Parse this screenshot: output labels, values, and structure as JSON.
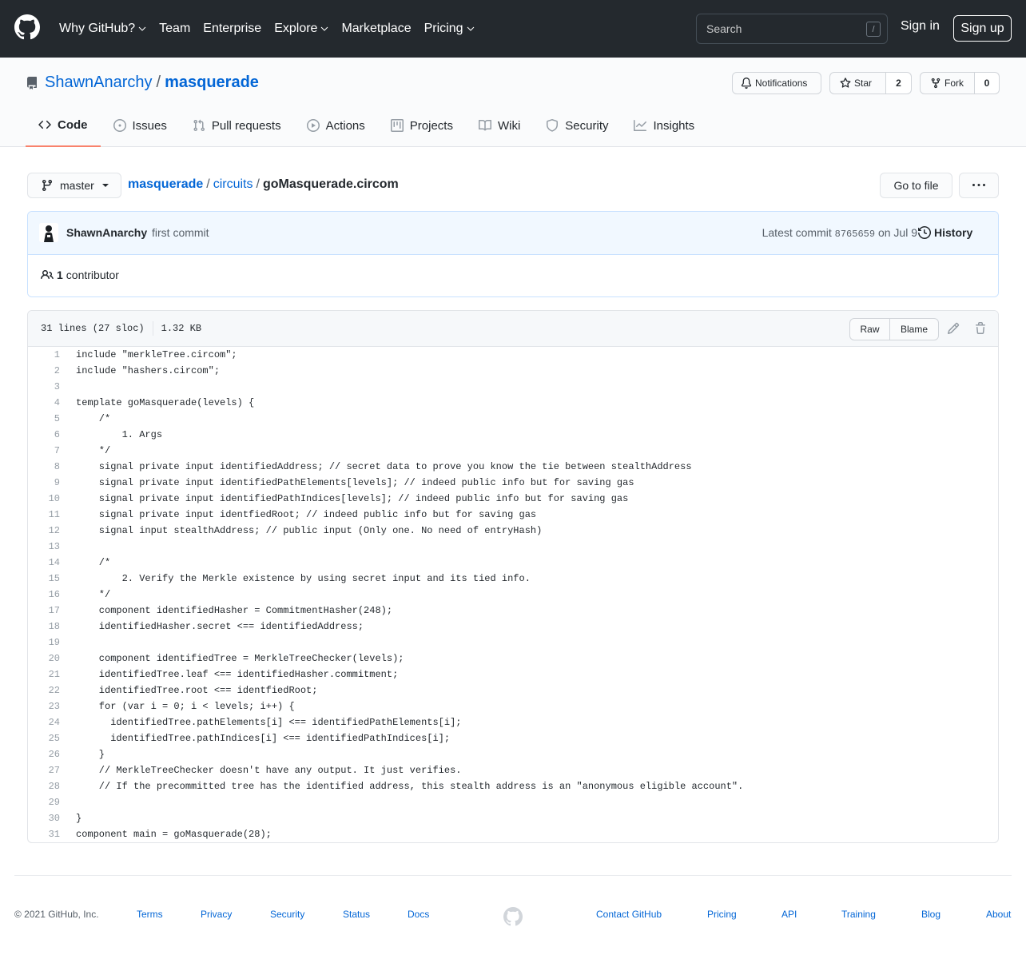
{
  "header": {
    "nav": [
      {
        "label": "Why GitHub?",
        "caret": true
      },
      {
        "label": "Team",
        "caret": false
      },
      {
        "label": "Enterprise",
        "caret": false
      },
      {
        "label": "Explore",
        "caret": true
      },
      {
        "label": "Marketplace",
        "caret": false
      },
      {
        "label": "Pricing",
        "caret": true
      }
    ],
    "search_placeholder": "Search",
    "search_hotkey": "/",
    "sign_in": "Sign in",
    "sign_up": "Sign up"
  },
  "repo": {
    "owner": "ShawnAnarchy",
    "separator": "/",
    "name": "masquerade",
    "notifications_label": "Notifications",
    "star_label": "Star",
    "star_count": "2",
    "fork_label": "Fork",
    "fork_count": "0"
  },
  "tabs": [
    {
      "label": "Code",
      "icon": "code-icon",
      "selected": true
    },
    {
      "label": "Issues",
      "icon": "issue-icon",
      "selected": false
    },
    {
      "label": "Pull requests",
      "icon": "pull-request-icon",
      "selected": false
    },
    {
      "label": "Actions",
      "icon": "play-icon",
      "selected": false
    },
    {
      "label": "Projects",
      "icon": "project-icon",
      "selected": false
    },
    {
      "label": "Wiki",
      "icon": "book-icon",
      "selected": false
    },
    {
      "label": "Security",
      "icon": "shield-icon",
      "selected": false
    },
    {
      "label": "Insights",
      "icon": "graph-icon",
      "selected": false
    }
  ],
  "branch": {
    "label": "master"
  },
  "breadcrumb": {
    "root": "masquerade",
    "dir": "circuits",
    "file": "goMasquerade.circom",
    "sep": "/"
  },
  "go_to_file": "Go to file",
  "commit": {
    "author": "ShawnAnarchy",
    "message": "first commit",
    "latest_prefix": "Latest commit",
    "sha": "8765659",
    "date_text": "on Jul 9",
    "history_label": "History"
  },
  "contributors": {
    "count": "1",
    "label": "contributor"
  },
  "file": {
    "lines_info": "31 lines (27 sloc)",
    "size": "1.32 KB",
    "raw_label": "Raw",
    "blame_label": "Blame"
  },
  "code_lines": [
    "include \"merkleTree.circom\";",
    "include \"hashers.circom\";",
    "",
    "template goMasquerade(levels) {",
    "    /*",
    "        1. Args",
    "    */",
    "    signal private input identifiedAddress; // secret data to prove you know the tie between stealthAddress",
    "    signal private input identifiedPathElements[levels]; // indeed public info but for saving gas",
    "    signal private input identifiedPathIndices[levels]; // indeed public info but for saving gas",
    "    signal private input identfiedRoot; // indeed public info but for saving gas",
    "    signal input stealthAddress; // public input (Only one. No need of entryHash)",
    "",
    "    /*",
    "        2. Verify the Merkle existence by using secret input and its tied info.",
    "    */",
    "    component identifiedHasher = CommitmentHasher(248);",
    "    identifiedHasher.secret <== identifiedAddress;",
    "",
    "    component identifiedTree = MerkleTreeChecker(levels);",
    "    identifiedTree.leaf <== identifiedHasher.commitment;",
    "    identifiedTree.root <== identfiedRoot;",
    "    for (var i = 0; i < levels; i++) {",
    "      identifiedTree.pathElements[i] <== identifiedPathElements[i];",
    "      identifiedTree.pathIndices[i] <== identifiedPathIndices[i];",
    "    }",
    "    // MerkleTreeChecker doesn't have any output. It just verifies.",
    "    // If the precommitted tree has the identified address, this stealth address is an \"anonymous eligible account\".",
    "",
    "}",
    "component main = goMasquerade(28);"
  ],
  "footer": {
    "copyright": "© 2021 GitHub, Inc.",
    "left_links": [
      "Terms",
      "Privacy",
      "Security",
      "Status",
      "Docs"
    ],
    "right_links": [
      "Contact GitHub",
      "Pricing",
      "API",
      "Training",
      "Blog",
      "About"
    ]
  }
}
